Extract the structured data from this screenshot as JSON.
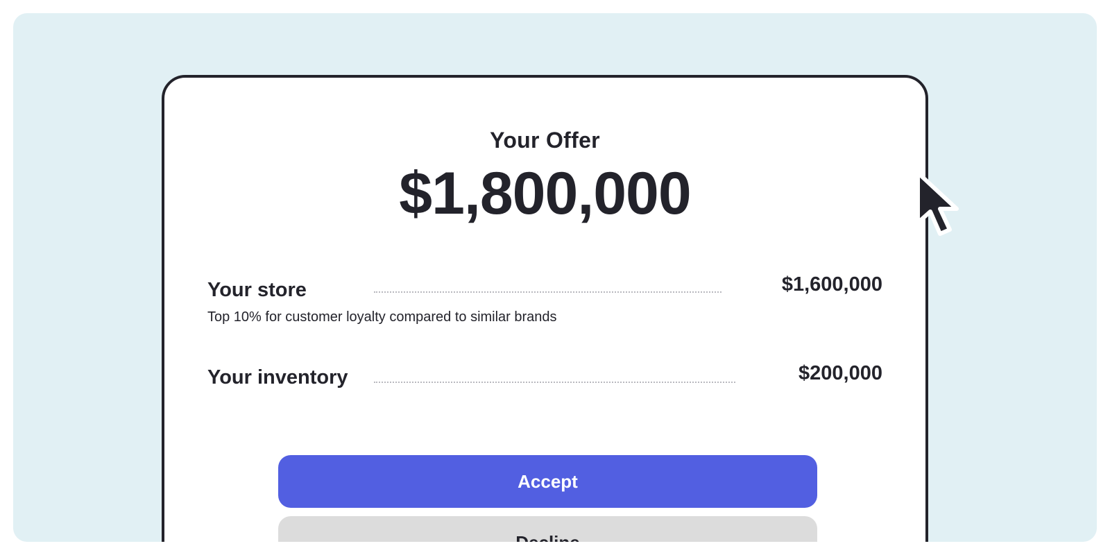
{
  "offer": {
    "label": "Your Offer",
    "amount": "$1,800,000"
  },
  "breakdown": {
    "store": {
      "title": "Your store",
      "value": "$1,600,000",
      "note": "Top 10% for customer loyalty compared to similar brands"
    },
    "inventory": {
      "title": "Your inventory",
      "value": "$200,000"
    }
  },
  "actions": {
    "accept_label": "Accept",
    "decline_label": "Decline"
  },
  "colors": {
    "background": "#e1f0f4",
    "accent": "#525fe1",
    "text": "#23232b",
    "decline": "#dcdcdc"
  },
  "icons": {
    "cursor": "mouse-pointer-icon"
  }
}
